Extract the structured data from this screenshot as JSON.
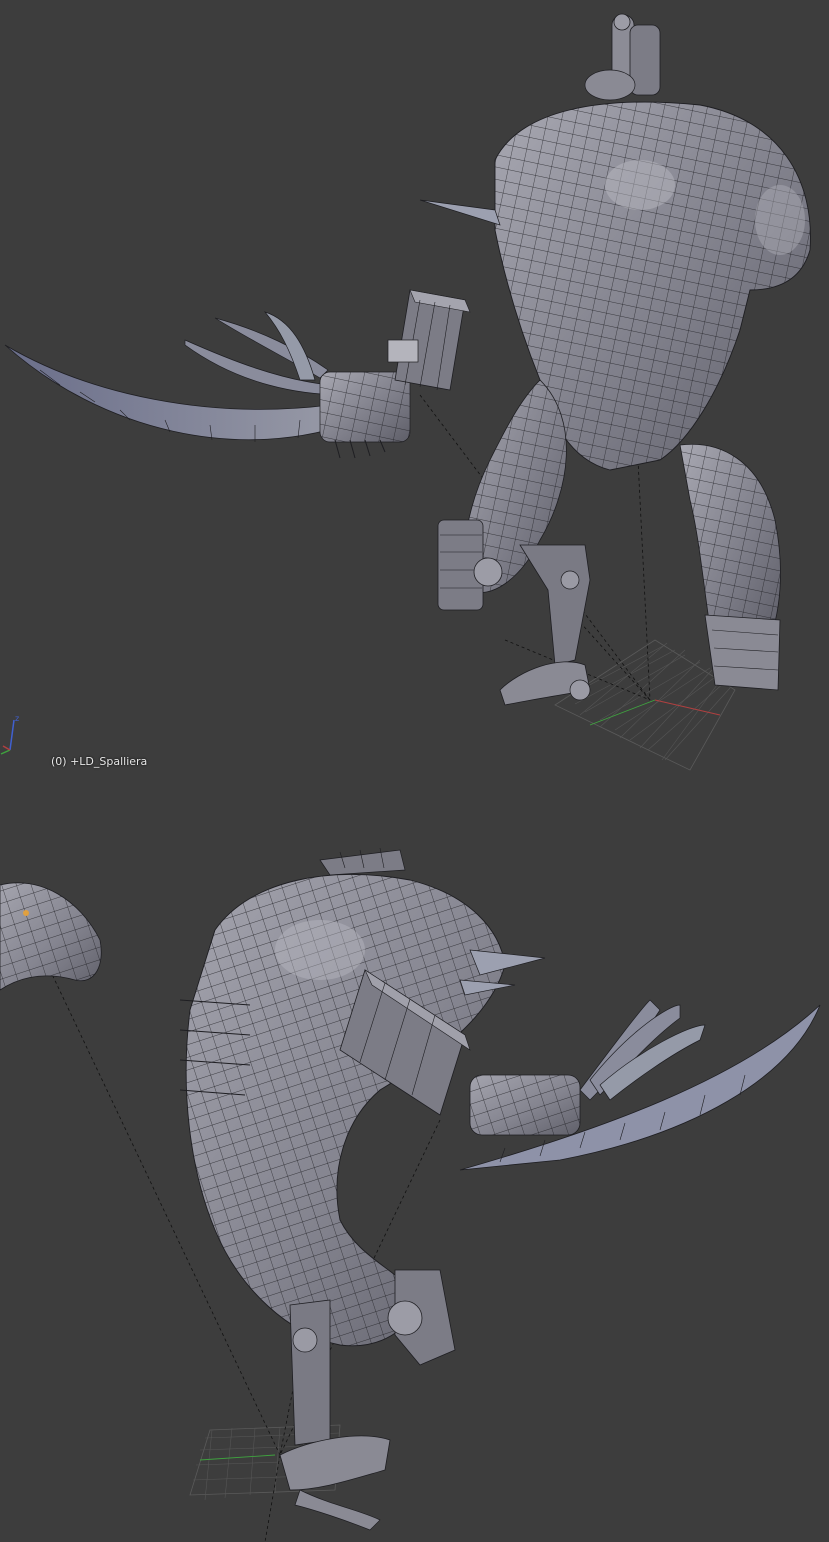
{
  "app": "Blender",
  "viewport_top": {
    "object_info": "(0) +LD_Spalliera",
    "axis_gizmo_icon": "axis-gizmo-icon"
  },
  "viewport_bottom": {},
  "colors": {
    "background": "#3d3d3d",
    "mesh": "#8e8e98",
    "wire": "#1e1e22",
    "grid": "#5a5a5a",
    "x_axis": "#b04040",
    "y_axis": "#3fa33f",
    "z_axis": "#4060d0"
  }
}
